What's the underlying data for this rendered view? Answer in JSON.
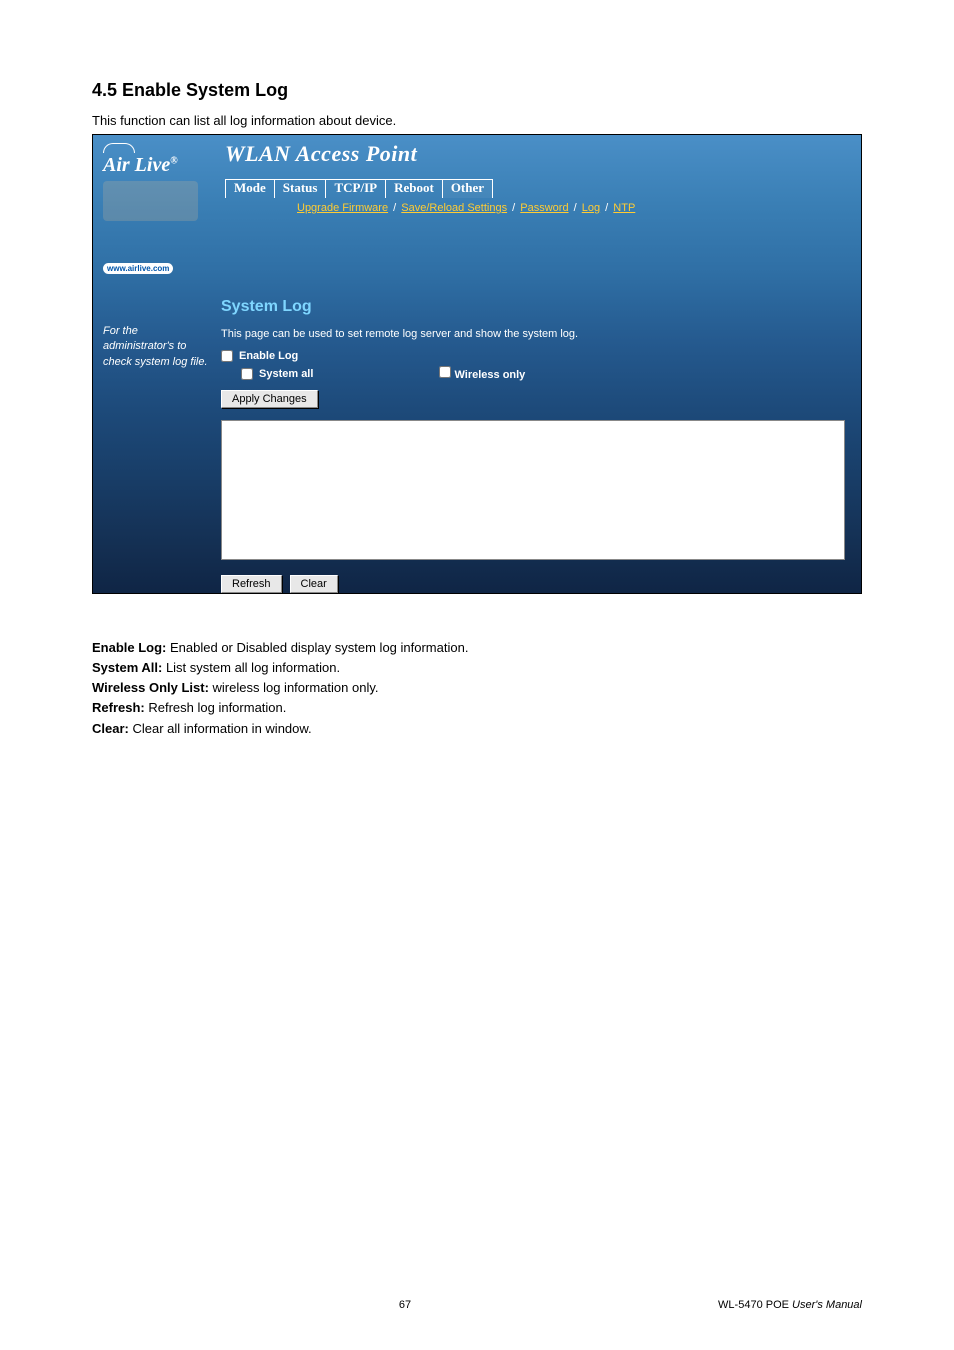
{
  "section": {
    "title": "4.5 Enable System Log",
    "intro": "This function can list all log information about device."
  },
  "screenshot": {
    "logo_text": "Air Live",
    "logo_reg": "®",
    "url_pill": "www.airlive.com",
    "wlan_title": "WLAN Access Point",
    "nav": {
      "mode": "Mode",
      "status": "Status",
      "tcpip": "TCP/IP",
      "reboot": "Reboot",
      "other": "Other"
    },
    "subnav": {
      "upgrade": "Upgrade Firmware",
      "save_reload": "Save/Reload Settings",
      "password": "Password",
      "log": "Log",
      "ntp": "NTP"
    },
    "side_text": "For the administrator's to check system log file.",
    "page_subtitle": "System Log",
    "page_desc": "This page can be used to set remote log server and show the system log.",
    "cb_enable": "Enable Log",
    "cb_system_all": "System all",
    "cb_wireless_only": "Wireless only",
    "btn_apply": "Apply Changes",
    "btn_refresh": "Refresh",
    "btn_clear": "Clear"
  },
  "descriptions": {
    "enable_log_term": "Enable Log:",
    "enable_log_text": " Enabled or Disabled display system log information.",
    "system_all_term": "System All:",
    "system_all_text": " List system all log information.",
    "wireless_only_term": "Wireless Only List:",
    "wireless_only_text": " wireless log information only.",
    "refresh_term": "Refresh:",
    "refresh_text": " Refresh log information.",
    "clear_term": "Clear:",
    "clear_text": " Clear all information in window."
  },
  "footer": {
    "page": "67",
    "model": "WL-5470 POE ",
    "manual": "User's Manual"
  }
}
